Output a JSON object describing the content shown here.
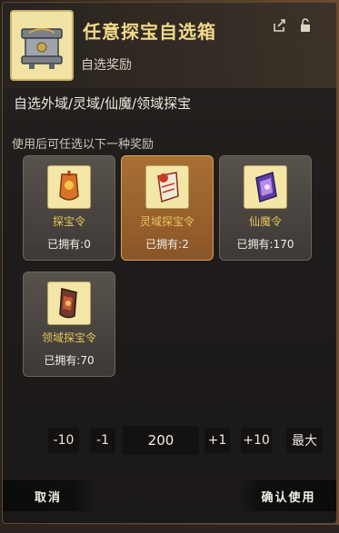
{
  "header": {
    "title": "任意探宝自选箱",
    "subtitle": "自选奖励",
    "icons": [
      "share-icon",
      "unlock-icon"
    ]
  },
  "description": "自选外域/灵域/仙魔/领域探宝",
  "hint": "使用后可任选以下一种奖励",
  "rewards": [
    {
      "name": "探宝令",
      "owned": "已拥有:0",
      "selected": false,
      "icon": "treasure-token-icon"
    },
    {
      "name": "灵域探宝令",
      "owned": "已拥有:2",
      "selected": true,
      "icon": "spirit-realm-token-icon"
    },
    {
      "name": "仙魔令",
      "owned": "已拥有:170",
      "selected": false,
      "icon": "immortal-demon-token-icon"
    },
    {
      "name": "领域探宝令",
      "owned": "已拥有:70",
      "selected": false,
      "icon": "domain-token-icon"
    }
  ],
  "quantity": {
    "minus10": "-10",
    "minus1": "-1",
    "value": "200",
    "plus1": "+1",
    "plus10": "+10",
    "max": "最大"
  },
  "actions": {
    "cancel": "取消",
    "confirm": "确认使用"
  },
  "colors": {
    "title": "#f2d98a",
    "selected_card": "#a97036",
    "card": "#58524c",
    "reward_name": "#e5c45b"
  }
}
